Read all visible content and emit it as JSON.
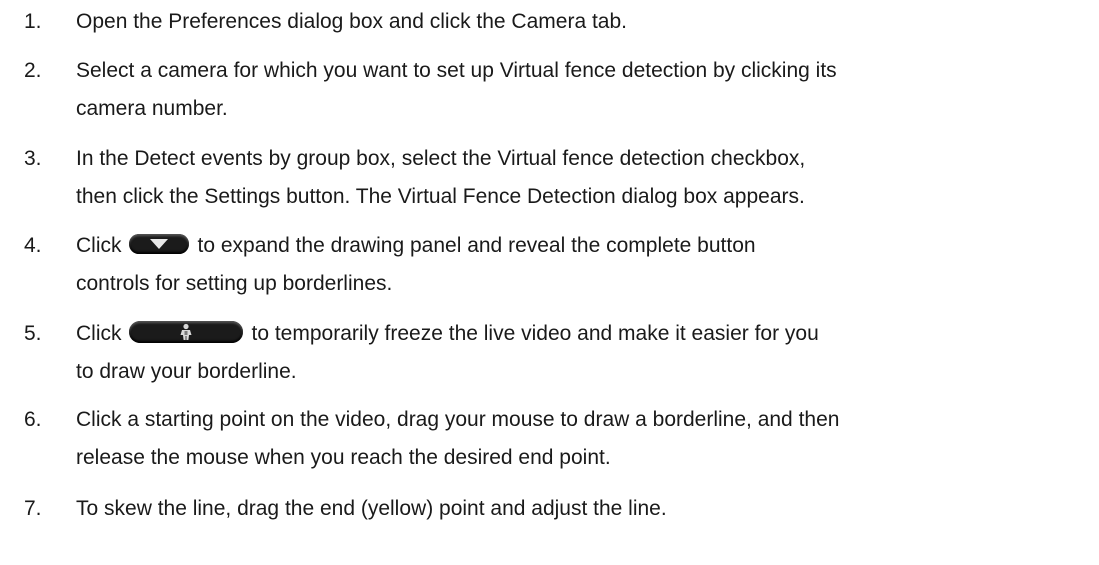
{
  "steps": [
    {
      "num": "1.",
      "lines": [
        "Open the Preferences dialog box and click the Camera tab."
      ]
    },
    {
      "num": "2.",
      "lines": [
        "Select a camera for which you want to set up Virtual fence detection by clicking its",
        "camera number."
      ]
    },
    {
      "num": "3.",
      "lines": [
        "In the Detect events by group box, select the Virtual fence detection checkbox,",
        "then click the Settings button. The Virtual Fence Detection dialog box appears."
      ]
    },
    {
      "num": "4.",
      "line1_before": "Click",
      "line1_after": "to expand the drawing panel and reveal the complete button",
      "line2": "controls for setting up borderlines.",
      "button_icon": "expand-triangle-icon"
    },
    {
      "num": "5.",
      "line1_before": "Click",
      "line1_after": "to temporarily freeze the live video and make it easier for you",
      "line2": "to draw your borderline.",
      "button_icon": "freeze-person-icon"
    },
    {
      "num": "6.",
      "lines": [
        "Click a starting point on the video, drag your mouse to draw a borderline, and then",
        "release the mouse when you reach the desired end point."
      ]
    },
    {
      "num": "7.",
      "lines": [
        "To skew the line, drag the end (yellow) point and adjust the line."
      ]
    }
  ],
  "colors": {
    "text": "#1a1a1a",
    "button": "#1b1b1b",
    "button_glyph": "#e8e8e8",
    "background": "#ffffff"
  }
}
